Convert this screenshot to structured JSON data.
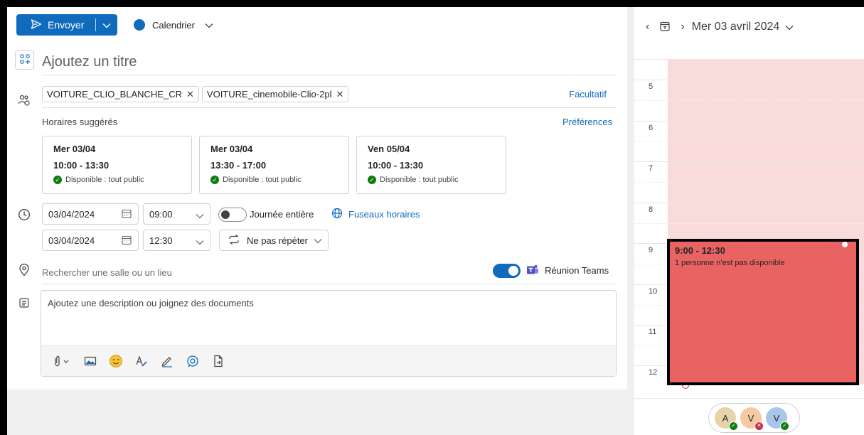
{
  "toolbar": {
    "send_label": "Envoyer",
    "calendar_label": "Calendrier",
    "brand_color": "#0f6cbd"
  },
  "form": {
    "title_placeholder": "Ajoutez un titre",
    "attendees": [
      {
        "name": "VOITURE_CLIO_BLANCHE_CR"
      },
      {
        "name": "VOITURE_cinemobile-Clio-2pl"
      }
    ],
    "optional_label": "Facultatif",
    "suggested_title": "Horaires suggérés",
    "preferences_label": "Préférences",
    "suggestions": [
      {
        "date": "Mer 03/04",
        "time": "10:00 - 13:30",
        "availability": "Disponible : tout public"
      },
      {
        "date": "Mer 03/04",
        "time": "13:30 - 17:00",
        "availability": "Disponible : tout public"
      },
      {
        "date": "Ven 05/04",
        "time": "10:00 - 13:30",
        "availability": "Disponible : tout public"
      }
    ],
    "start_date": "03/04/2024",
    "start_time": "09:00",
    "end_date": "03/04/2024",
    "end_time": "12:30",
    "all_day_label": "Journée entière",
    "all_day_on": false,
    "timezones_label": "Fuseaux horaires",
    "repeat_label": "Ne pas répéter",
    "location_placeholder": "Rechercher une salle ou un lieu",
    "teams_label": "Réunion Teams",
    "teams_on": true,
    "description_placeholder": "Ajoutez une description ou joignez des documents"
  },
  "calendar": {
    "date_label": "Mer 03 avril 2024",
    "hours": [
      "5",
      "6",
      "7",
      "8",
      "9",
      "10",
      "11",
      "12"
    ],
    "event": {
      "time": "9:00 - 12:30",
      "message": "1 personne n’est pas disponible",
      "color": "#ea6363"
    },
    "busy_color": "#fadbdb",
    "avatars": [
      {
        "initial": "A",
        "color": "#e8d3a8",
        "status": "available",
        "status_color": "#107c10"
      },
      {
        "initial": "V",
        "color": "#f7c9a3",
        "status": "unavailable",
        "status_color": "#c4314b"
      },
      {
        "initial": "V",
        "color": "#a9c5ea",
        "status": "available",
        "status_color": "#107c10"
      }
    ]
  }
}
